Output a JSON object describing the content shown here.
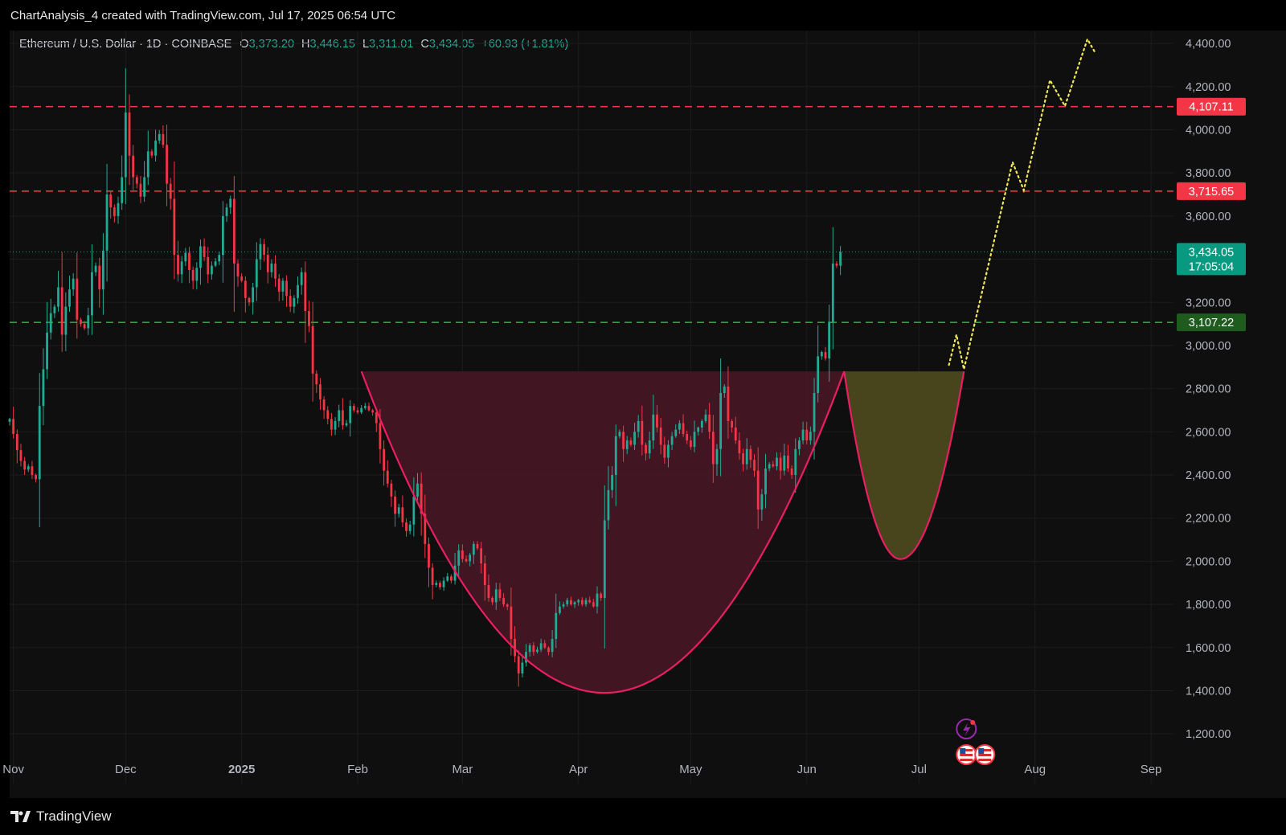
{
  "header": {
    "title": "ChartAnalysis_4 created with TradingView.com, Jul 17, 2025 06:54 UTC"
  },
  "legend": {
    "symbol": "Ethereum / U.S. Dollar · 1D · COINBASE",
    "open_key": "O",
    "open": "3,373.20",
    "high_key": "H",
    "high": "3,446.15",
    "low_key": "L",
    "low": "3,311.01",
    "close_key": "C",
    "close": "3,434.05",
    "change": "+60.93 (+1.81%)"
  },
  "footer": {
    "brand": "TradingView"
  },
  "colors": {
    "bull": "#22ab94",
    "bear": "#f23645",
    "resistance": "#f23645",
    "support": "#2ea043",
    "cup_fill": "#4a1626",
    "cup_line": "#e91e63",
    "handle_fill": "#4f4a1e",
    "projection": "#f0e85a",
    "background": "#0f0f0f"
  },
  "chart_data": {
    "type": "candlestick",
    "title": "Ethereum / U.S. Dollar · 1D · COINBASE",
    "ylim": [
      1100,
      4460
    ],
    "xlim": [
      "2024-10-31",
      "2025-09-07"
    ],
    "y_ticks": [
      1200,
      1400,
      1600,
      1800,
      2000,
      2200,
      2400,
      2600,
      2800,
      3000,
      3200,
      3400,
      3600,
      3800,
      4000,
      4200,
      4400
    ],
    "y_tick_labels": [
      "1,200.00",
      "1,400.00",
      "1,600.00",
      "1,800.00",
      "2,000.00",
      "2,200.00",
      "2,400.00",
      "2,600.00",
      "2,800.00",
      "3,000.00",
      "3,200.00",
      "3,400.00",
      "3,600.00",
      "3,800.00",
      "4,000.00",
      "4,200.00",
      "4,400.00"
    ],
    "x_ticks": [
      {
        "date": "2024-11-01",
        "label": "Nov",
        "bold": false
      },
      {
        "date": "2024-12-01",
        "label": "Dec",
        "bold": false
      },
      {
        "date": "2025-01-01",
        "label": "2025",
        "bold": true
      },
      {
        "date": "2025-02-01",
        "label": "Feb",
        "bold": false
      },
      {
        "date": "2025-03-01",
        "label": "Mar",
        "bold": false
      },
      {
        "date": "2025-04-01",
        "label": "Apr",
        "bold": false
      },
      {
        "date": "2025-05-01",
        "label": "May",
        "bold": false
      },
      {
        "date": "2025-06-01",
        "label": "Jun",
        "bold": false
      },
      {
        "date": "2025-07-01",
        "label": "Jul",
        "bold": false
      },
      {
        "date": "2025-08-01",
        "label": "Aug",
        "bold": false
      },
      {
        "date": "2025-09-01",
        "label": "Sep",
        "bold": false
      }
    ],
    "closes_start_date": "2024-10-31",
    "closes": [
      2660,
      2590,
      2515,
      2465,
      2425,
      2440,
      2400,
      2380,
      2720,
      2890,
      3060,
      3150,
      3180,
      3270,
      3050,
      3180,
      3260,
      3310,
      3120,
      3100,
      3080,
      3140,
      3340,
      3370,
      3260,
      3440,
      3700,
      3640,
      3600,
      3660,
      3780,
      4080,
      3880,
      3780,
      3750,
      3690,
      3780,
      3900,
      3880,
      3950,
      3980,
      3930,
      3750,
      3680,
      3420,
      3330,
      3390,
      3430,
      3350,
      3300,
      3360,
      3460,
      3410,
      3330,
      3370,
      3390,
      3420,
      3600,
      3640,
      3680,
      3380,
      3320,
      3300,
      3220,
      3200,
      3270,
      3400,
      3470,
      3420,
      3340,
      3380,
      3310,
      3250,
      3300,
      3230,
      3180,
      3220,
      3280,
      3340,
      3160,
      3090,
      2870,
      2820,
      2750,
      2700,
      2660,
      2610,
      2650,
      2700,
      2630,
      2640,
      2720,
      2700,
      2690,
      2710,
      2720,
      2700,
      2690,
      2640,
      2520,
      2420,
      2360,
      2300,
      2220,
      2250,
      2180,
      2140,
      2170,
      2300,
      2360,
      2220,
      2080,
      1970,
      1890,
      1900,
      1880,
      1910,
      1930,
      1910,
      1980,
      2050,
      2010,
      2000,
      2030,
      2080,
      2060,
      1990,
      1890,
      1830,
      1810,
      1870,
      1830,
      1800,
      1790,
      1640,
      1560,
      1480,
      1530,
      1580,
      1610,
      1580,
      1590,
      1620,
      1600,
      1580,
      1640,
      1760,
      1790,
      1800,
      1820,
      1800,
      1810,
      1820,
      1800,
      1820,
      1810,
      1790,
      1850,
      1830,
      2190,
      2330,
      2400,
      2580,
      2600,
      2520,
      2560,
      2540,
      2600,
      2650,
      2540,
      2500,
      2560,
      2680,
      2620,
      2540,
      2480,
      2540,
      2580,
      2610,
      2640,
      2590,
      2560,
      2530,
      2600,
      2620,
      2650,
      2680,
      2600,
      2450,
      2520,
      2780,
      2810,
      2650,
      2620,
      2560,
      2500,
      2450,
      2520,
      2470,
      2420,
      2240,
      2310,
      2430,
      2450,
      2440,
      2480,
      2420,
      2490,
      2430,
      2400,
      2520,
      2560,
      2610,
      2560,
      2600,
      2780,
      2950,
      2970,
      2940,
      3110,
      3380,
      3370,
      3434
    ],
    "last_price": 3434.05,
    "last_price_label": "3,434.05",
    "countdown": "17:05:04",
    "levels": [
      {
        "name": "resistance",
        "value": 4107.11,
        "label": "4,107.11",
        "color": "#f23645"
      },
      {
        "name": "resistance",
        "value": 3715.65,
        "label": "3,715.65",
        "color": "#f23645"
      },
      {
        "name": "support",
        "value": 3107.22,
        "label": "3,107.22",
        "color": "#2ea043"
      }
    ],
    "cup": {
      "start_date": "2025-02-02",
      "bottom_date": "2025-04-08",
      "end_date": "2025-06-11",
      "rim": 2880,
      "bottom": 1390
    },
    "handle": {
      "start_date": "2025-06-11",
      "bottom_date": "2025-06-26",
      "end_date": "2025-07-13",
      "rim": 2880,
      "bottom": 2010
    },
    "projection": [
      [
        "2025-07-09",
        2910
      ],
      [
        "2025-07-11",
        3050
      ],
      [
        "2025-07-13",
        2890
      ],
      [
        "2025-07-26",
        3850
      ],
      [
        "2025-07-29",
        3720
      ],
      [
        "2025-08-05",
        4230
      ],
      [
        "2025-08-09",
        4110
      ],
      [
        "2025-08-15",
        4420
      ],
      [
        "2025-08-17",
        4360
      ]
    ]
  }
}
